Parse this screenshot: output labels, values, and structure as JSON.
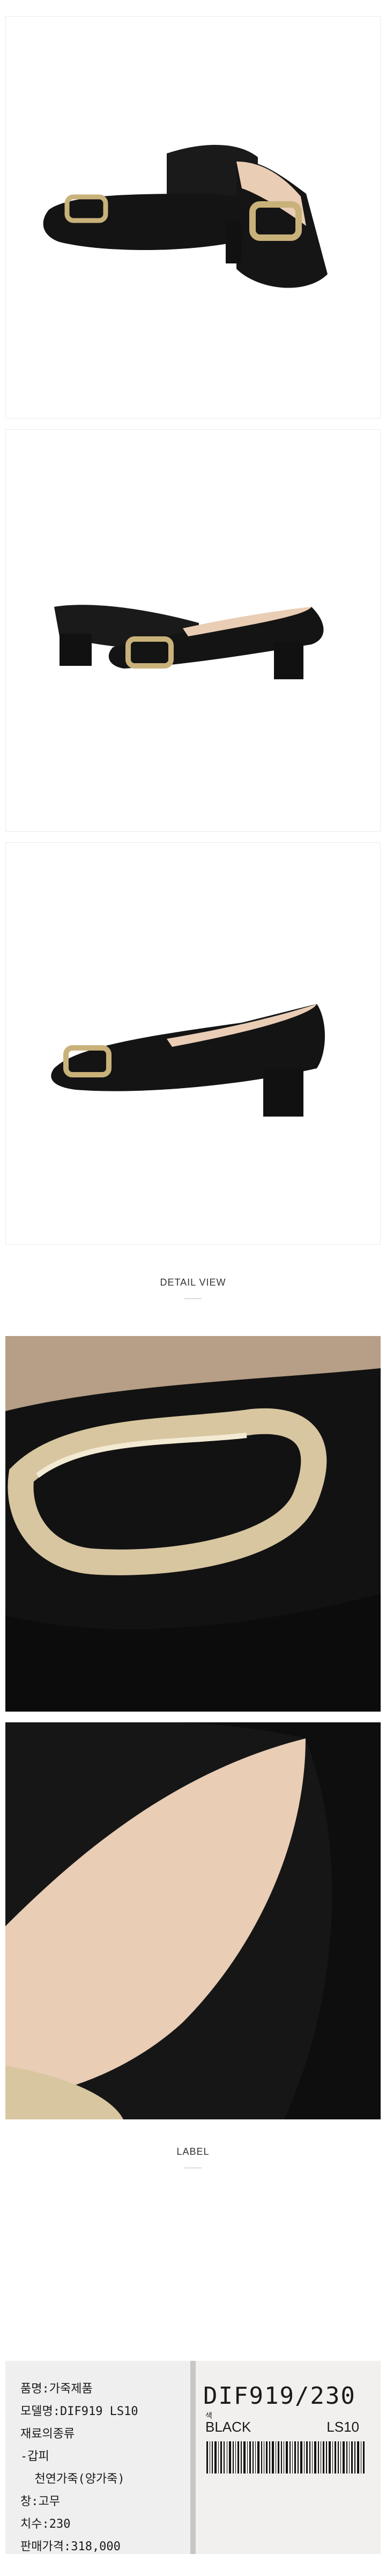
{
  "sections": {
    "detail_view": "DETAIL VIEW",
    "label": "LABEL"
  },
  "label_tag": {
    "lines": [
      "품명:가죽제품",
      "모델명:DIF919 LS10",
      "재료의종류",
      "-갑피",
      "  천연가죽(양가죽)",
      "창:고무",
      "치수:230",
      "판매가격:318,000"
    ],
    "code": "DIF919/230",
    "color_code": "색",
    "color_name": "BLACK",
    "size_code": "LS10"
  },
  "colors": {
    "leather": "#141414",
    "gold": "#c9b27a",
    "insole": "#e9cdb5"
  }
}
